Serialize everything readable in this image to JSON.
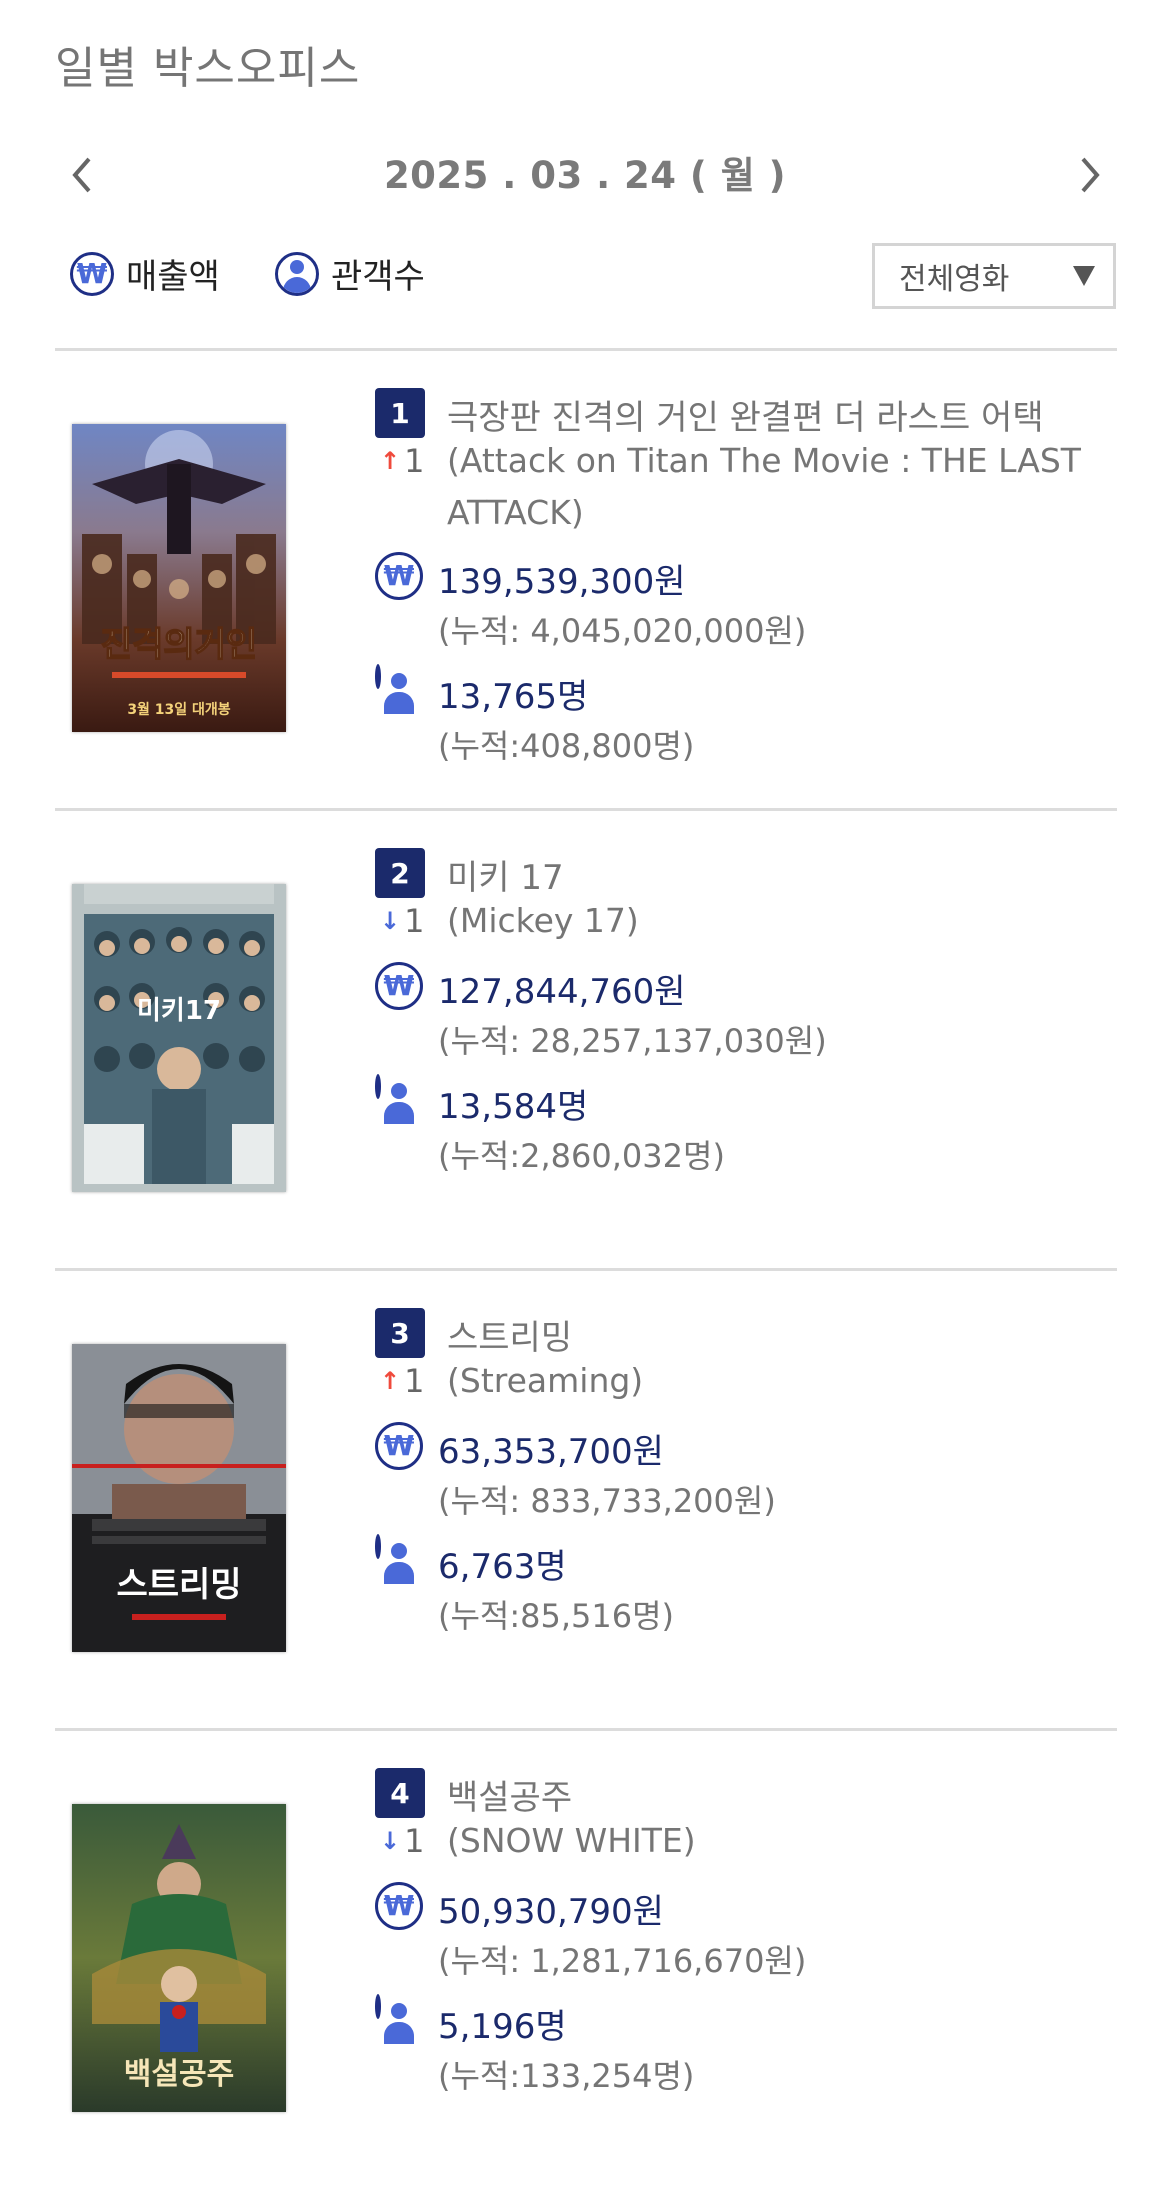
{
  "header": {
    "title": "일별 박스오피스"
  },
  "date_nav": {
    "date": "2025 . 03 . 24 ( 월 )"
  },
  "toggles": {
    "sales_label": "매출액",
    "audience_label": "관객수",
    "won_symbol": "₩"
  },
  "filter": {
    "selected": "전체영화"
  },
  "colors": {
    "navy": "#1b2a6b",
    "up": "#ef4a3c",
    "down": "#4a69d8"
  },
  "movies": [
    {
      "rank": "1",
      "change_dir": "up",
      "change_arrow": "↑",
      "change_value": "1",
      "title_ko": "극장판 진격의 거인 완결편 더 라스트 어택",
      "title_en": "(Attack on Titan The Movie : THE LAST ATTACK)",
      "sales": "139,539,300원",
      "sales_cum": "(누적: 4,045,020,000원)",
      "audience": "13,765명",
      "audience_cum": "(누적:408,800명)",
      "poster_caption": "진격의거인"
    },
    {
      "rank": "2",
      "change_dir": "down",
      "change_arrow": "↓",
      "change_value": "1",
      "title_ko": "미키 17",
      "title_en": "(Mickey 17)",
      "sales": "127,844,760원",
      "sales_cum": "(누적: 28,257,137,030원)",
      "audience": "13,584명",
      "audience_cum": "(누적:2,860,032명)",
      "poster_caption": "미키17"
    },
    {
      "rank": "3",
      "change_dir": "up",
      "change_arrow": "↑",
      "change_value": "1",
      "title_ko": "스트리밍",
      "title_en": "(Streaming)",
      "sales": "63,353,700원",
      "sales_cum": "(누적: 833,733,200원)",
      "audience": "6,763명",
      "audience_cum": "(누적:85,516명)",
      "poster_caption": "스트리밍"
    },
    {
      "rank": "4",
      "change_dir": "down",
      "change_arrow": "↓",
      "change_value": "1",
      "title_ko": "백설공주",
      "title_en": "(SNOW WHITE)",
      "sales": "50,930,790원",
      "sales_cum": "(누적: 1,281,716,670원)",
      "audience": "5,196명",
      "audience_cum": "(누적:133,254명)",
      "poster_caption": "백설공주"
    }
  ]
}
